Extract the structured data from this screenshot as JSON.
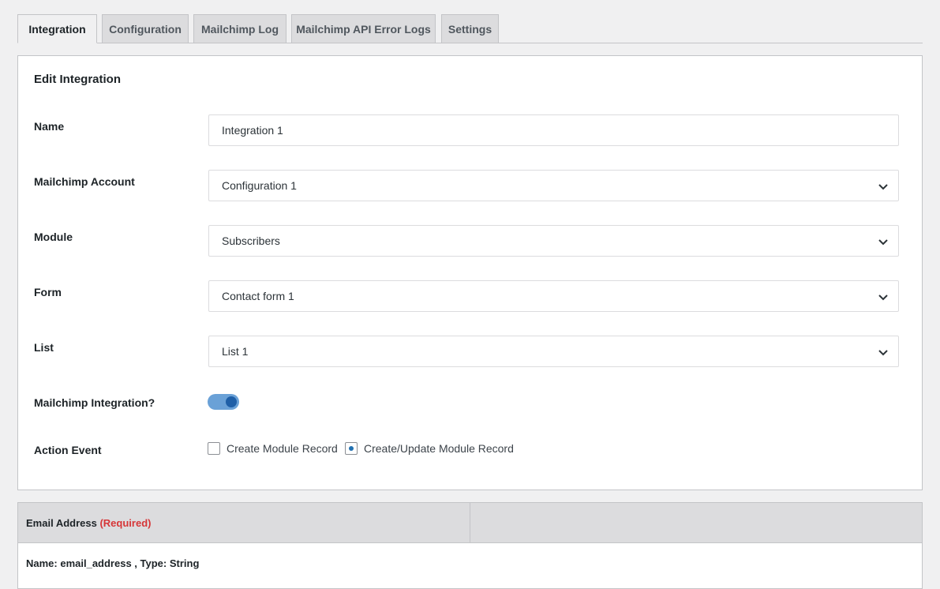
{
  "tabs": [
    {
      "label": "Integration",
      "active": true
    },
    {
      "label": "Configuration",
      "active": false
    },
    {
      "label": "Mailchimp Log",
      "active": false
    },
    {
      "label": "Mailchimp API Error Logs",
      "active": false
    },
    {
      "label": "Settings",
      "active": false
    }
  ],
  "form": {
    "title": "Edit Integration",
    "name": {
      "label": "Name",
      "value": "Integration 1"
    },
    "account": {
      "label": "Mailchimp Account",
      "value": "Configuration 1"
    },
    "module": {
      "label": "Module",
      "value": "Subscribers"
    },
    "form_select": {
      "label": "Form",
      "value": "Contact form 1"
    },
    "list": {
      "label": "List",
      "value": "List 1"
    },
    "integration_toggle": {
      "label": "Mailchimp Integration?",
      "on": true
    },
    "action_event": {
      "label": "Action Event",
      "options": [
        {
          "label": "Create Module Record",
          "checked": false
        },
        {
          "label": "Create/Update Module Record",
          "checked": true
        }
      ]
    }
  },
  "mapping_table": {
    "header": "Email Address",
    "required_label": "(Required)",
    "row_text": "Name: email_address , Type: String"
  },
  "colors": {
    "accent": "#2271b1",
    "toggle_track": "#6aa1d7",
    "required": "#d63638"
  }
}
